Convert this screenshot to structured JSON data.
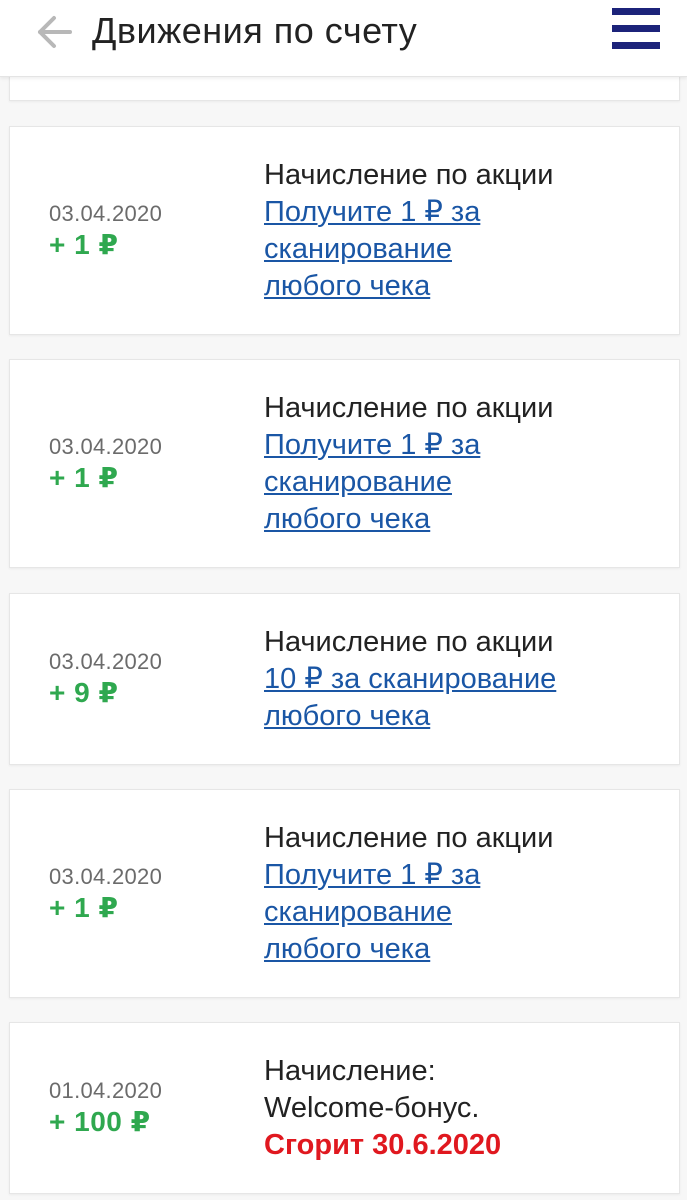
{
  "header": {
    "title": "Движения по счету"
  },
  "colors": {
    "accent_menu": "#1c237a",
    "amount_green": "#2fa84f",
    "link_blue": "#1a56a5",
    "expire_red": "#e0181f"
  },
  "transactions": [
    {
      "date": "03.04.2020",
      "amount": "+ 1 ₽",
      "description": "Начисление по акции",
      "link_lines": [
        "Получите 1 ₽ за",
        "сканирование",
        "любого чека"
      ]
    },
    {
      "date": "03.04.2020",
      "amount": "+ 1 ₽",
      "description": "Начисление по акции",
      "link_lines": [
        "Получите 1 ₽ за",
        "сканирование",
        "любого чека"
      ]
    },
    {
      "date": "03.04.2020",
      "amount": "+ 9 ₽",
      "description": "Начисление по акции",
      "link_lines": [
        "10 ₽ за сканирование",
        "любого чека"
      ]
    },
    {
      "date": "03.04.2020",
      "amount": "+ 1 ₽",
      "description": "Начисление по акции",
      "link_lines": [
        "Получите 1 ₽ за",
        "сканирование",
        "любого чека"
      ]
    },
    {
      "date": "01.04.2020",
      "amount": "+ 100 ₽",
      "description_lines": [
        "Начисление:",
        "Welcome-бонус."
      ],
      "expire_text": "Сгорит 30.6.2020"
    }
  ]
}
